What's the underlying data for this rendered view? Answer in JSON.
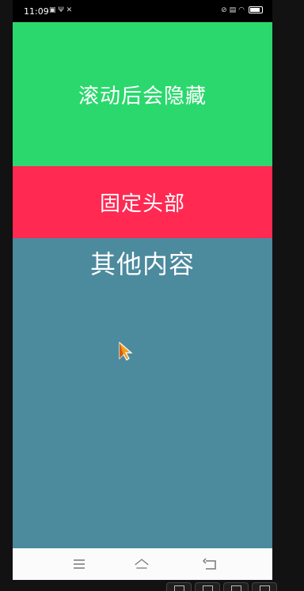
{
  "status_bar": {
    "time": "11:09",
    "left_icons": [
      "image-icon",
      "usb-icon",
      "tools-icon"
    ],
    "right_icons": [
      "mute-icon",
      "doc-icon",
      "wifi-icon",
      "battery-icon"
    ]
  },
  "header": {
    "scroll_hide_label": "滚动后会隐藏",
    "sticky_label": "固定头部"
  },
  "content": {
    "title": "其他内容"
  },
  "colors": {
    "green_header": "#2bd86d",
    "red_header": "#ff2952",
    "content_bg": "#4c8a9e"
  },
  "nav_bar": {
    "buttons": [
      "menu-icon",
      "home-icon",
      "back-icon"
    ]
  }
}
